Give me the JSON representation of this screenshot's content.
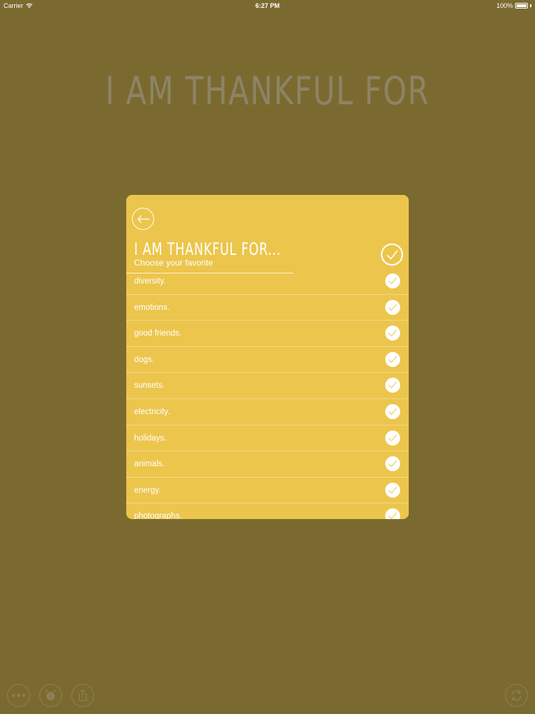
{
  "status_bar": {
    "carrier": "Carrier",
    "time": "6:27 PM",
    "battery": "100%"
  },
  "title": "I AM THANKFUL FOR",
  "card": {
    "title": "I AM THANKFUL FOR...",
    "subtitle": "Choose your favorite",
    "items": [
      {
        "label": "diversity."
      },
      {
        "label": "emotions."
      },
      {
        "label": "good friends."
      },
      {
        "label": "dogs."
      },
      {
        "label": "sunsets."
      },
      {
        "label": "electricity."
      },
      {
        "label": "holidays."
      },
      {
        "label": "animals."
      },
      {
        "label": "energy."
      },
      {
        "label": "photographs."
      }
    ]
  },
  "toolbar": {
    "buttons": [
      {
        "icon": "more-icon"
      },
      {
        "icon": "alarm-icon"
      },
      {
        "icon": "share-icon"
      },
      {
        "icon": "refresh-icon"
      }
    ]
  },
  "colors": {
    "background": "#7b6a30",
    "card": "#ecc54c",
    "title": "#8d8466"
  }
}
